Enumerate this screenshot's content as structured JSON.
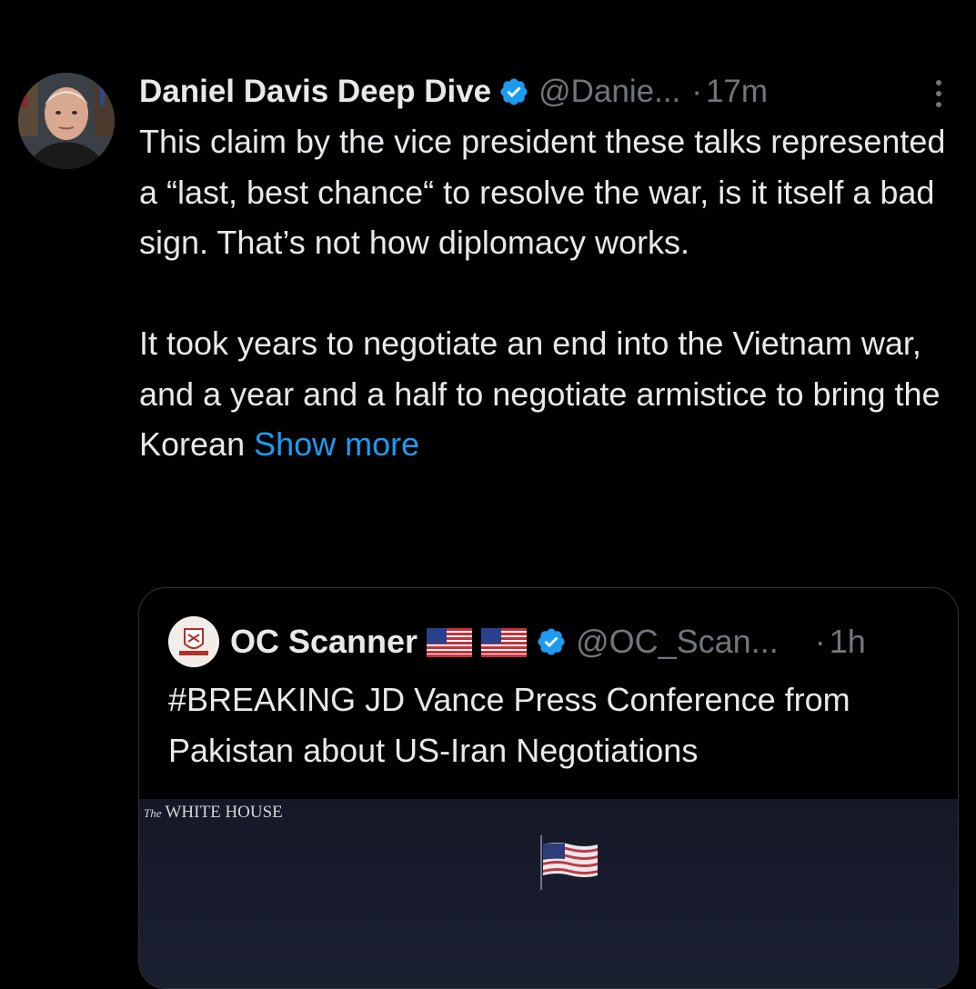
{
  "tweet": {
    "display_name": "Daniel Davis Deep Dive",
    "handle": "@Danie...",
    "separator": "·",
    "time": "17m",
    "body": "This claim by the vice president these talks represented a “last, best chance“ to resolve the war, is it itself a bad sign. That’s not how diplomacy works.\n\nIt took years to negotiate an end into the Vietnam war, and a year and a half to negotiate armistice to bring the Korean ",
    "show_more": "Show more",
    "icons": {
      "verified": "verified-badge-icon",
      "more": "more-options-icon"
    }
  },
  "quote": {
    "display_name": "OC Scanner",
    "flags": [
      "🇺🇸",
      "🇺🇸"
    ],
    "handle": "@OC_Scan...",
    "separator": "·",
    "time": "1h",
    "text": "#BREAKING JD Vance Press Conference from Pakistan about US-Iran Negotiations",
    "media": {
      "logo_the": "The",
      "logo_text": "WHITE HOUSE"
    }
  },
  "colors": {
    "background": "#000000",
    "text": "#e7e9ea",
    "secondary": "#71767b",
    "accent": "#1d9bf0",
    "border": "#2f3336"
  }
}
